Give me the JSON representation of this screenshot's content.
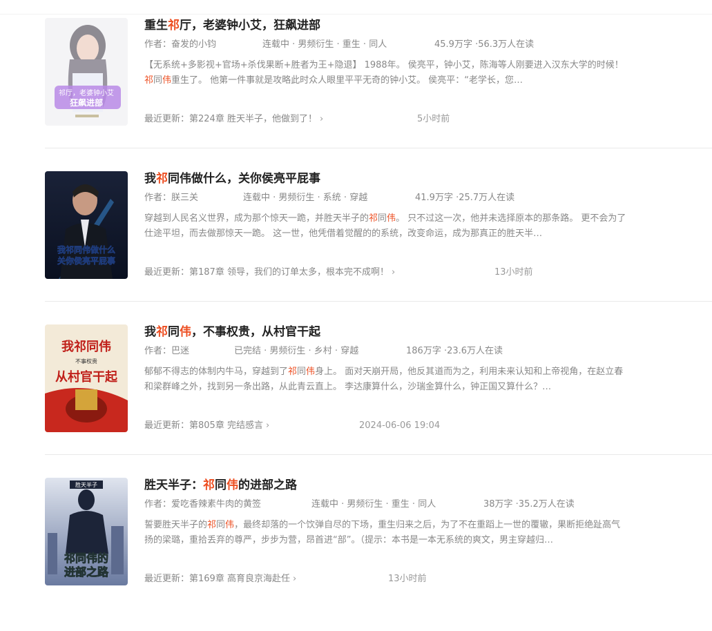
{
  "books": [
    {
      "title_pre": "重生",
      "title_hl": "祁",
      "title_post": "厅，老婆钟小艾，狂飙进部",
      "author": "作者：奋发的小钧",
      "status": "连载中 · 男频衍生 · 重生 · 同人",
      "stats": "45.9万字 ·56.3万人在读",
      "desc_a": "【无系统+多影视+官场+杀伐果断+胜者为王+隐退】 1988年。 侯亮平，钟小艾，陈海等人刚要进入汉东大学的时候！ ",
      "desc_hl1": "祁",
      "desc_b": "同",
      "desc_hl2": "伟",
      "desc_c": "重生了。 他第一件事就是攻略此时众人眼里平平无奇的钟小艾。 侯亮平：“老学长，您…",
      "update": "最近更新：第224章 胜天半子，他做到了！",
      "time": "5小时前",
      "cover_text1": "祁厅，老婆钟小艾",
      "cover_text2": "狂飙进部"
    },
    {
      "title_pre": "我",
      "title_hl": "祁",
      "title_post": "同伟做什么，关你侯亮平屁事",
      "author": "作者：朕三关",
      "status": "连载中 · 男频衍生 · 系统 · 穿越",
      "stats": "41.9万字 ·25.7万人在读",
      "desc_a": "穿越到人民名义世界，成为那个惊天一跪，并胜天半子的",
      "desc_hl1": "祁",
      "desc_b": "同",
      "desc_hl2": "伟",
      "desc_c": "。 只不过这一次，他并未选择原本的那条路。 更不会为了仕途平坦，而去做那惊天一跪。 这一世，他凭借着觉醒的的系统，改变命运，成为那真正的胜天半…",
      "update": "最近更新：第187章 领导，我们的订单太多，根本完不成啊！",
      "time": "13小时前",
      "cover_text1": "我祁同伟做什么",
      "cover_text2": "关你侯亮平屁事"
    },
    {
      "title_pre": "我",
      "title_hl": "祁",
      "title_mid": "同",
      "title_hl2": "伟",
      "title_post": "，不事权贵，从村官干起",
      "author": "作者：巴迷",
      "status": "已完结 · 男频衍生 · 乡村 · 穿越",
      "stats": "186万字 ·23.6万人在读",
      "desc_a": "郁郁不得志的体制内牛马，穿越到了",
      "desc_hl1": "祁",
      "desc_b": "同",
      "desc_hl2": "伟",
      "desc_c": "身上。 面对天崩开局，他反其道而为之，利用未来认知和上帝视角，在赵立春和梁群峰之外，找到另一条出路，从此青云直上。 李达康算什么，沙瑞金算什么，钟正国又算什么？…",
      "update": "最近更新：第805章 完结感言",
      "time": "2024-06-06 19:04",
      "cover_text1": "我祁同伟",
      "cover_text2": "从村官干起",
      "cover_small": "不事权贵"
    },
    {
      "title_pre": "胜天半子：",
      "title_hl": "祁",
      "title_mid": "同",
      "title_hl2": "伟",
      "title_post": "的进部之路",
      "author": "作者：爱吃香辣素牛肉的黄签",
      "status": "连载中 · 男频衍生 · 重生 · 同人",
      "stats": "38万字 ·35.2万人在读",
      "desc_a": "誓要胜天半子的",
      "desc_hl1": "祁",
      "desc_b": "同",
      "desc_hl2": "伟",
      "desc_c": "，最终却落的一个饮弹自尽的下场，重生归来之后，为了不在重蹈上一世的覆辙，果断拒绝趾高气扬的梁璐，重拾丢弃的尊严，步步为营，昂首进“部”。（提示：本书是一本无系统的爽文，男主穿越归…",
      "update": "最近更新：第169章 高育良京海赴任",
      "time": "13小时前",
      "cover_text1": "胜天半子",
      "cover_text2": "祁同伟的",
      "cover_text3": "进部之路"
    }
  ],
  "colors": {
    "highlight": "#ed4e21",
    "meta": "#888888",
    "title": "#222222"
  },
  "icons": {
    "update_arrow": "chevron-right-icon"
  }
}
